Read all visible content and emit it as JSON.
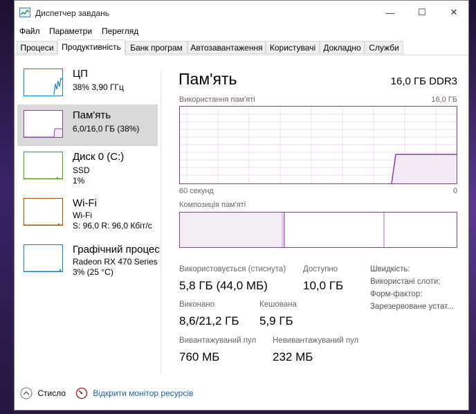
{
  "window": {
    "title": "Диспетчер завдань",
    "minimize": "—",
    "maximize": "☐",
    "close": "✕"
  },
  "menu": [
    "Файл",
    "Параметри",
    "Перегляд"
  ],
  "tabs": [
    {
      "label": "Процеси",
      "active": false
    },
    {
      "label": "Продуктивність",
      "active": true
    },
    {
      "label": "Банк програм",
      "active": false
    },
    {
      "label": "Автозавантаження",
      "active": false
    },
    {
      "label": "Користувачі",
      "active": false
    },
    {
      "label": "Докладно",
      "active": false
    },
    {
      "label": "Служби",
      "active": false
    }
  ],
  "sidebar": [
    {
      "title": "ЦП",
      "lines": [
        "38% 3,90 ГГц"
      ],
      "color": "#1a83c4",
      "selected": false
    },
    {
      "title": "Пам'ять",
      "lines": [
        "6,0/16,0 ГБ (38%)"
      ],
      "color": "#8b3d9b",
      "selected": true
    },
    {
      "title": "Диск 0 (C:)",
      "lines": [
        "SSD",
        "1%"
      ],
      "color": "#4da60c",
      "selected": false
    },
    {
      "title": "Wi-Fi",
      "lines": [
        "Wi-Fi",
        "S: 96,0 R: 96,0 Кбіт/с"
      ],
      "color": "#a74f01",
      "selected": false
    },
    {
      "title": "Графічний процес",
      "lines": [
        "Radeon RX 470 Series",
        "3% (25 °C)"
      ],
      "color": "#1a83c4",
      "selected": false
    }
  ],
  "main": {
    "title": "Пам'ять",
    "spec": "16,0 ГБ DDR3",
    "graph_label": "Використання пам'яті",
    "graph_max": "16,0 ГБ",
    "time_left": "60 секунд",
    "time_right": "0",
    "composition_label": "Композиція пам'яті",
    "usage_fraction": 0.38
  },
  "stats": {
    "in_use_label": "Використовується (стиснута)",
    "in_use_value": "5,8 ГБ (44,0 МБ)",
    "available_label": "Доступно",
    "available_value": "10,0 ГБ",
    "committed_label": "Виконано",
    "committed_value": "8,6/21,2 ГБ",
    "cached_label": "Кешована",
    "cached_value": "5,9 ГБ",
    "paged_label": "Вивантажуваний пул",
    "paged_value": "760 МБ",
    "nonpaged_label": "Невивантажуваний пул",
    "nonpaged_value": "232 МБ",
    "speed_label": "Швидкість:",
    "slots_label": "Використані слоти:",
    "form_label": "Форм-фактор:",
    "reserved_label": "Зарезервоване устат..."
  },
  "footer": {
    "fewer_details": "Стисло",
    "open_monitor": "Відкрити монітор ресурсів"
  },
  "colors": {
    "memory": "#8b3d9b",
    "link": "#1a5fb4"
  }
}
